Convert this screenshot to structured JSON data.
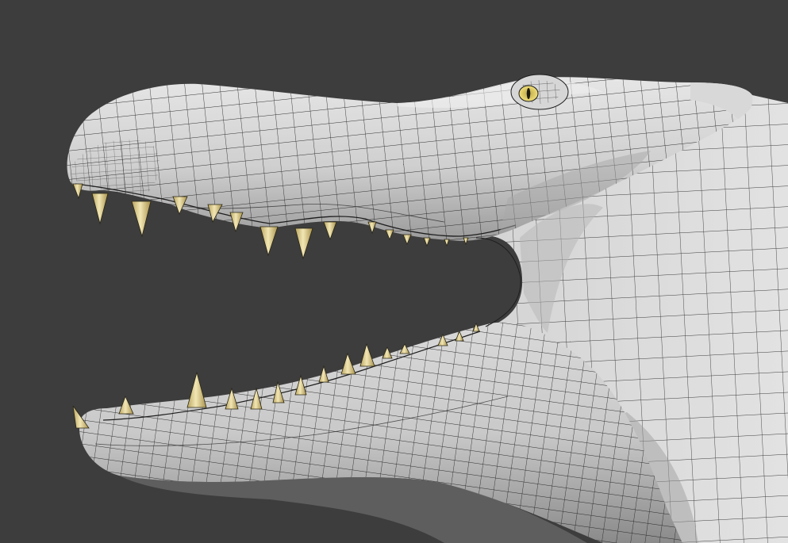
{
  "viewport": {
    "background_color": "#3d3d3d"
  },
  "model": {
    "subject": "crocodile-head",
    "display_mode": "wireframe-on-shaded",
    "mouth_open": true,
    "colors": {
      "skin_light": "#e4e4e4",
      "skin_mid": "#c4c4c4",
      "skin_shadow": "#8f8f8f",
      "wire": "#1e1e1e",
      "tooth_light": "#f2e5b0",
      "tooth_dark": "#b29d55",
      "eye_iris": "#e2cf66",
      "eye_pupil": "#1a1a10"
    }
  }
}
